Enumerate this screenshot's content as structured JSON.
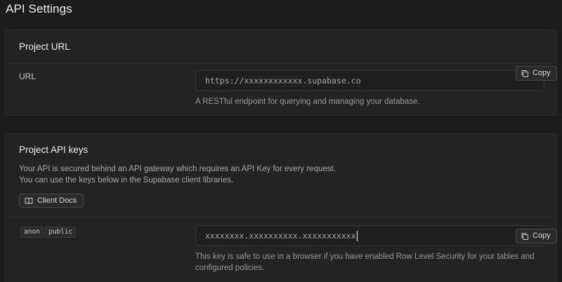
{
  "page": {
    "title": "API Settings"
  },
  "project_url": {
    "title": "Project URL",
    "label": "URL",
    "value": "https://xxxxxxxxxxxx.supabase.co",
    "copy_label": "Copy",
    "helper": "A RESTful endpoint for querying and managing your database."
  },
  "api_keys": {
    "title": "Project API keys",
    "desc_line1": "Your API is secured behind an API gateway which requires an API Key for every request.",
    "desc_line2": "You can use the keys below in the Supabase client libraries.",
    "docs_label": "Client Docs",
    "tags": [
      "anon",
      "public"
    ],
    "key_value": "xxxxxxxx.xxxxxxxxxx.xxxxxxxxxxx",
    "copy_label": "Copy",
    "helper_line1": "This key is safe to use in a browser if you have enabled Row Level Security for your tables and",
    "helper_line2": "configured policies."
  },
  "icons": {
    "copy": "copy-icon",
    "docs": "book-icon"
  },
  "colors": {
    "background": "#1c1c1c",
    "panel": "#232323",
    "input": "#1f1f1f"
  }
}
